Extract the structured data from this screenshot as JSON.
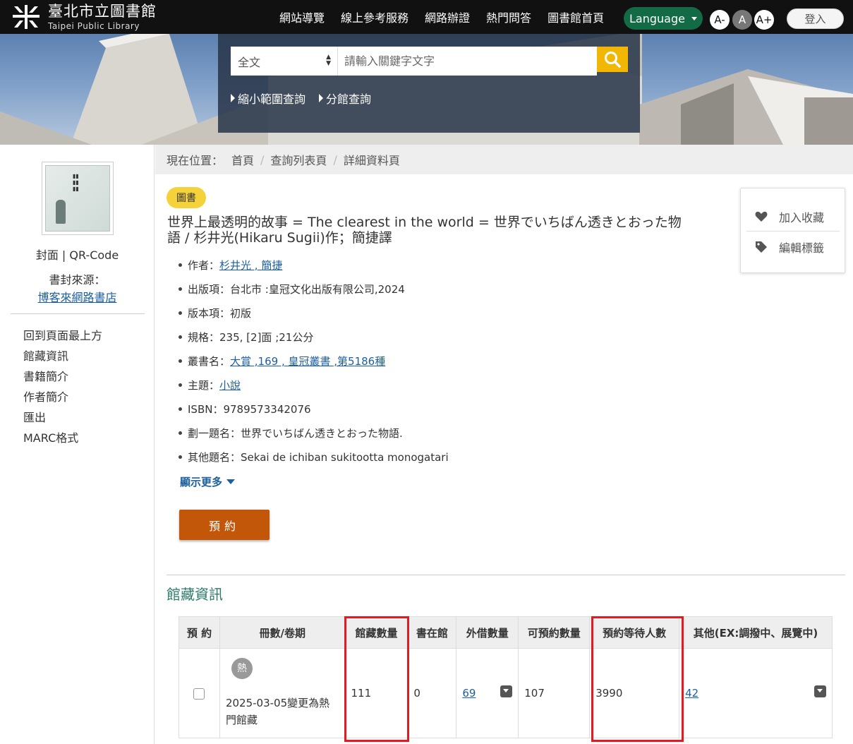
{
  "header": {
    "logo_text_cn": "臺北市立圖書館",
    "logo_text_en": "Taipei Public Library",
    "nav": [
      "網站導覽",
      "線上參考服務",
      "網路辦證",
      "熱門問答",
      "圖書館首頁"
    ],
    "language_label": "Language",
    "font_small": "A-",
    "font_medium": "A",
    "font_large": "A+",
    "login_label": "登入"
  },
  "search": {
    "scope_selected": "全文",
    "placeholder": "請輸入關鍵字文字",
    "link_narrow": "縮小範圍查詢",
    "link_branch": "分館查詢"
  },
  "sidebar": {
    "cover_label": "封面 | QR-Code",
    "cover_source_label": "書封來源：",
    "cover_source_link": "博客來網路書店",
    "nav": [
      "回到頁面最上方",
      "館藏資訊",
      "書籍簡介",
      "作者簡介",
      "匯出",
      "MARC格式"
    ]
  },
  "breadcrumb": {
    "prefix": "現在位置：",
    "items": [
      "首頁",
      "查詢列表頁",
      "詳細資料頁"
    ]
  },
  "record": {
    "type_badge": "圖書",
    "title": "世界上最透明的故事 = The clearest in the world = 世界でいちばん透きとおった物語 / 杉井光(Hikaru Sugii)作；簡捷譯",
    "author_label": "作者：",
    "author_value": "杉井光 , 簡捷",
    "publish_label": "出版項：",
    "publish_value": "台北市 :皇冠文化出版有限公司,2024",
    "edition_label": "版本項：",
    "edition_value": "初版",
    "spec_label": "規格：",
    "spec_value": "235, [2]面 ;21公分",
    "series_label": "叢書名：",
    "series_value": "大賞 ,169 , 皇冠叢書 ,第5186種",
    "subject_label": "主題：",
    "subject_value": "小說",
    "isbn_label": "ISBN：",
    "isbn_value": "9789573342076",
    "uniform_label": "劃一題名：",
    "uniform_value": "世界でいちばん透きとおった物語.",
    "other_label": "其他題名：",
    "other_value": "Sekai de ichiban sukitootta monogatari",
    "show_more": "顯示更多",
    "reserve_button": "預約"
  },
  "actions": {
    "favorite": "加入收藏",
    "edit_tags": "編輯標籤"
  },
  "holdings": {
    "section_title": "館藏資訊",
    "columns": [
      "預 約",
      "冊數/卷期",
      "館藏數量",
      "書在館",
      "外借數量",
      "可預約數量",
      "預約等待人數",
      "其他(EX:調撥中、展覽中)"
    ],
    "row": {
      "hot_badge": "熱",
      "volume_note": "2025-03-05變更為熱門館藏",
      "total": "111",
      "in_library": "0",
      "on_loan": "69",
      "reservable": "107",
      "waiting": "3990",
      "other": "42"
    }
  },
  "colors": {
    "topbar": "#111111",
    "language_button": "#136b46",
    "search_button": "#f2b705",
    "reserve_button": "#c2570a",
    "badge": "#f5d23a",
    "highlight": "#e01b24",
    "section_title": "#2a7a6a",
    "link": "#1c5f9e"
  }
}
